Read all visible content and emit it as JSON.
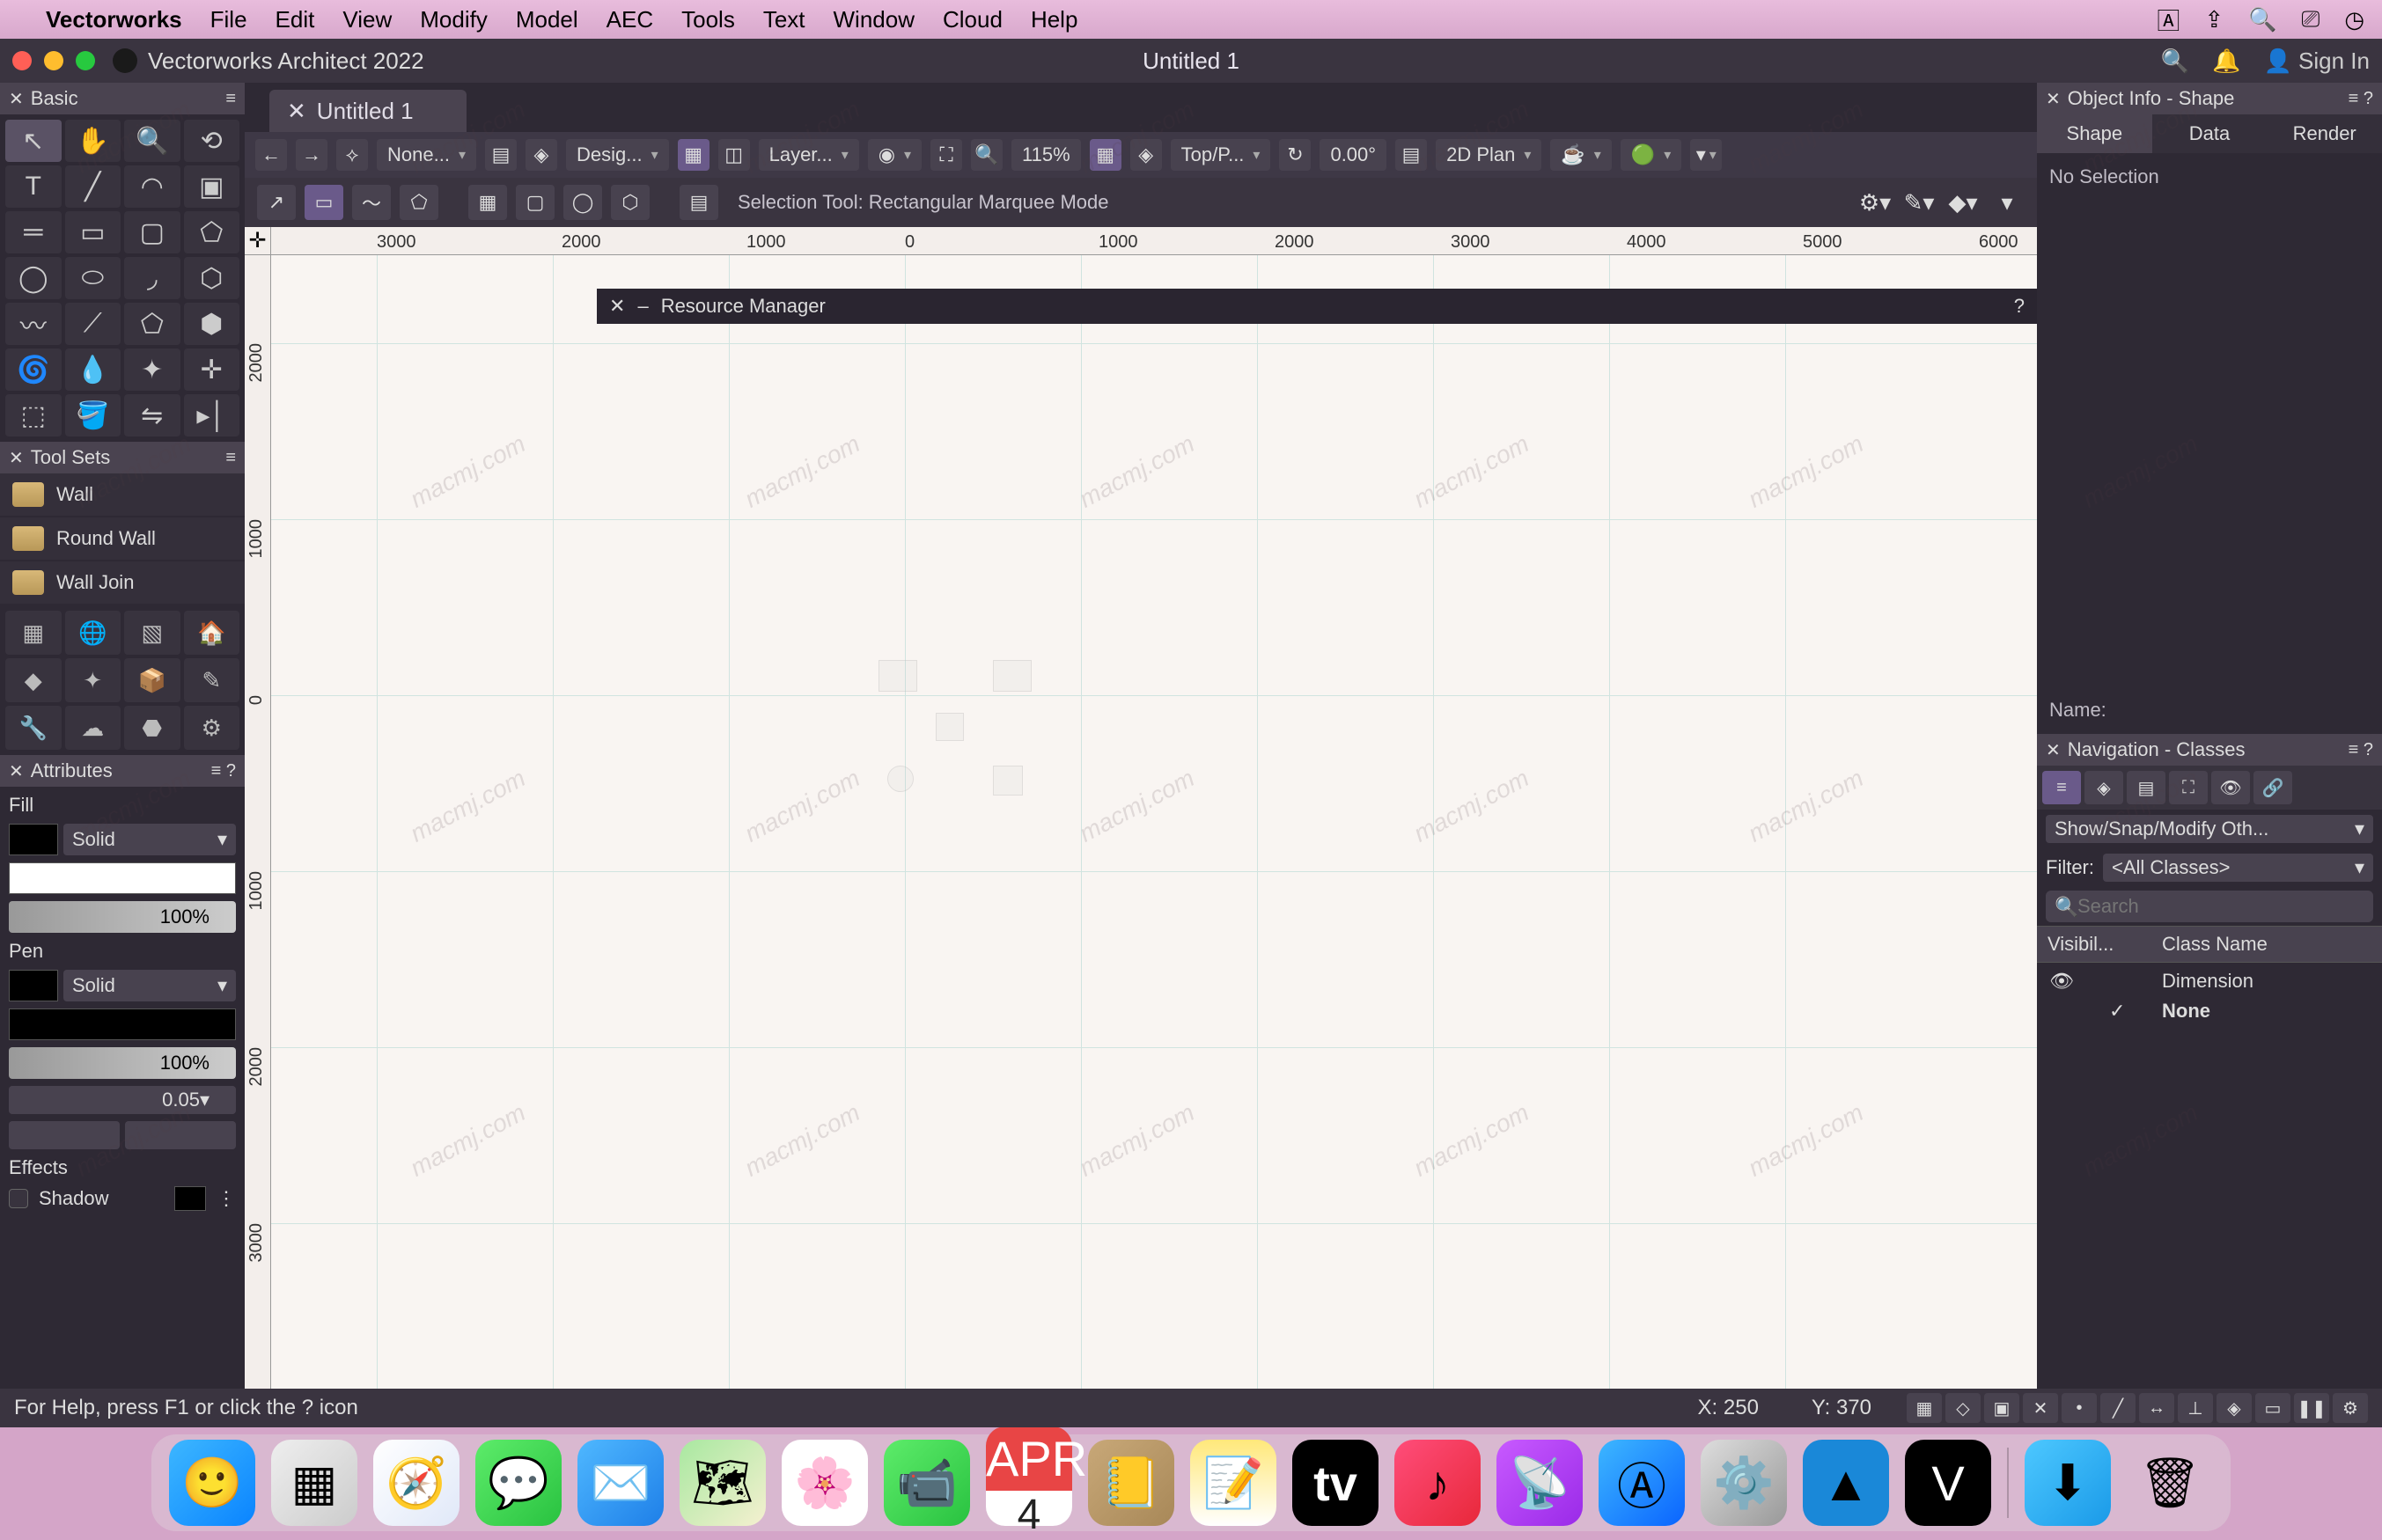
{
  "menubar": {
    "app": "Vectorworks",
    "items": [
      "File",
      "Edit",
      "View",
      "Modify",
      "Model",
      "AEC",
      "Tools",
      "Text",
      "Window",
      "Cloud",
      "Help"
    ]
  },
  "titlebar": {
    "app_title": "Vectorworks Architect 2022",
    "doc_title": "Untitled 1",
    "sign_in": "Sign In"
  },
  "doctab": {
    "label": "Untitled 1"
  },
  "viewbar": {
    "class": "None...",
    "layer": "Desig...",
    "layeropts": "Layer...",
    "zoom": "115%",
    "planview": "Top/P...",
    "angle": "0.00°",
    "rendermode": "2D Plan"
  },
  "modebar": {
    "hint": "Selection Tool: Rectangular Marquee Mode"
  },
  "resmgr": {
    "title": "Resource Manager"
  },
  "ruler_h": [
    "3000",
    "2000",
    "1000",
    "0",
    "1000",
    "2000",
    "3000",
    "4000",
    "5000",
    "6000"
  ],
  "ruler_v": [
    "2000",
    "1000",
    "0",
    "1000",
    "2000",
    "3000"
  ],
  "palettes": {
    "basic": {
      "title": "Basic"
    },
    "toolsets": {
      "title": "Tool Sets",
      "items": [
        "Wall",
        "Round Wall",
        "Wall Join"
      ]
    },
    "attributes": {
      "title": "Attributes",
      "fill_label": "Fill",
      "fill_type": "Solid",
      "fill_opacity": "100%",
      "pen_label": "Pen",
      "pen_type": "Solid",
      "pen_opacity": "100%",
      "line_weight": "0.05",
      "effects_label": "Effects",
      "shadow_label": "Shadow"
    }
  },
  "oip": {
    "title": "Object Info - Shape",
    "tabs": [
      "Shape",
      "Data",
      "Render"
    ],
    "no_selection": "No Selection",
    "name_label": "Name:"
  },
  "nav": {
    "title": "Navigation - Classes",
    "showmod": "Show/Snap/Modify Oth...",
    "filter_label": "Filter:",
    "filter_value": "<All Classes>",
    "search_placeholder": "Search",
    "cols": [
      "Visibil...",
      "Class Name"
    ],
    "rows": [
      {
        "vis": "eye",
        "chk": "",
        "name": "Dimension"
      },
      {
        "vis": "",
        "chk": "✓",
        "name": "None"
      }
    ]
  },
  "statusbar": {
    "help": "For Help, press F1 or click the ? icon",
    "x_label": "X:",
    "x_val": "250",
    "y_label": "Y:",
    "y_val": "370"
  },
  "dock": {
    "calendar_month": "APR",
    "calendar_day": "4",
    "tv": "tv"
  },
  "watermark": "macmj.com"
}
